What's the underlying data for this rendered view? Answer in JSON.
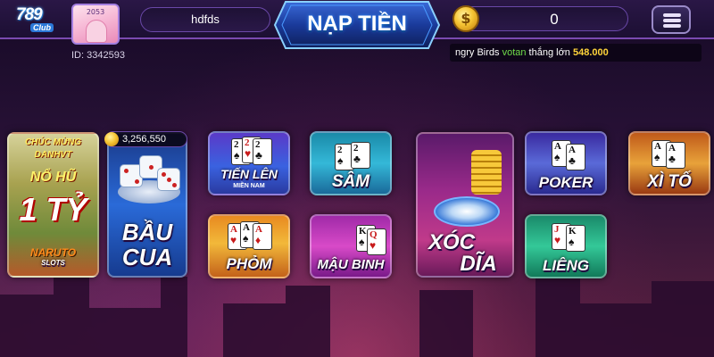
{
  "header": {
    "logo_number": "789",
    "logo_club": "Club",
    "avatar_points": "2053",
    "user_id": "ID: 3342593",
    "username": "hdfds",
    "deposit_label": "NẠP TIỀN",
    "coin_symbol": "$",
    "balance": "0"
  },
  "ticker": {
    "part1": "ngry Birds ",
    "part2": "votan",
    "part3": " thắng lớn ",
    "part4": "548.000"
  },
  "games": {
    "naruto": {
      "line1": "CHÚC MỪNG",
      "line2": "DANHVT",
      "line3": "NỔ HŨ",
      "line4": "1 TỶ",
      "line5": "NARUTO",
      "line6": "SLOTS"
    },
    "baucua": {
      "jackpot": "3,256,550",
      "title_line1": "BẦU",
      "title_line2": "CUA"
    },
    "tienlen": {
      "title": "TIẾN LÊN",
      "subtitle": "MIỀN NAM"
    },
    "sam": {
      "title": "SÂM"
    },
    "phom": {
      "title": "PHỎM"
    },
    "maubinh": {
      "title": "MẬU BINH"
    },
    "xocdia": {
      "title_line1": "XÓC",
      "title_line2": "DĨA"
    },
    "poker": {
      "title": "POKER"
    },
    "lieng": {
      "title": "LIÊNG"
    },
    "xito": {
      "title": "XÌ TỐ"
    }
  },
  "colors": {
    "accent": "#2b8dff",
    "winner": "#6fdc4a",
    "amount": "#ffd43a"
  },
  "icons": {
    "menu": "hamburger-icon",
    "coin": "coin-icon",
    "jackpot": "coin-icon"
  }
}
